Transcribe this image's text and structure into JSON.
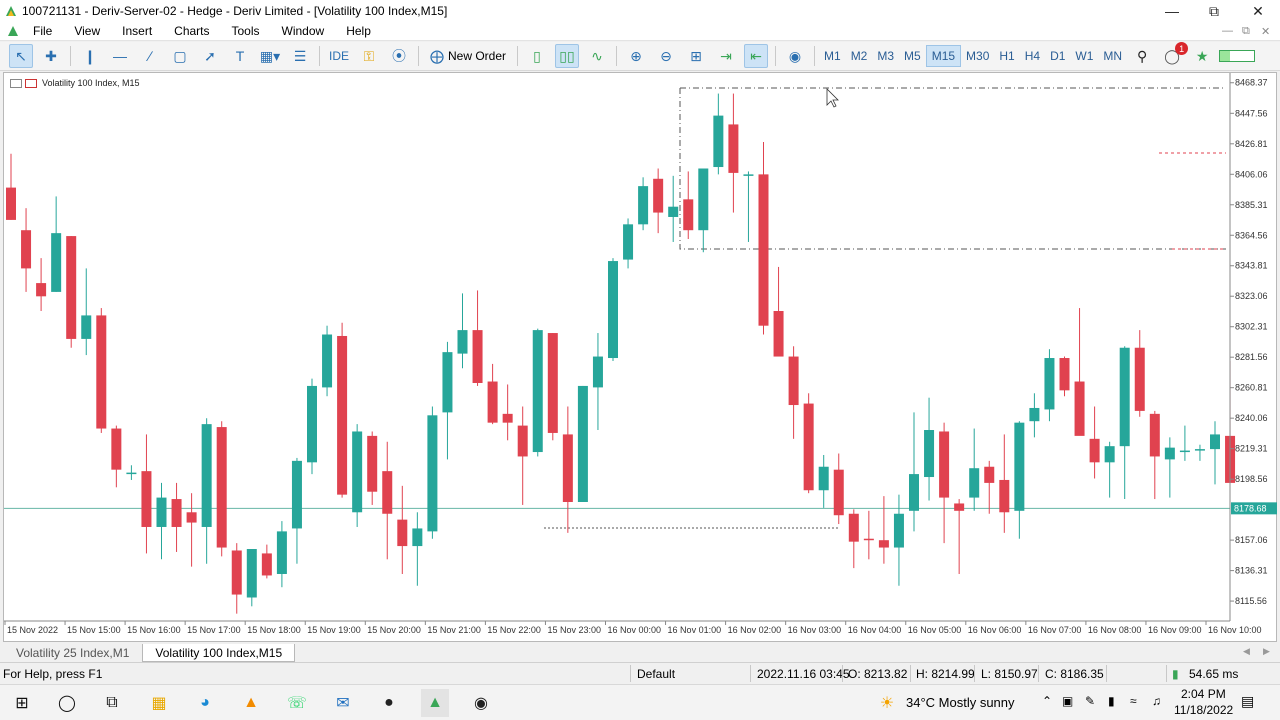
{
  "window": {
    "title": "100721131 - Deriv-Server-02 - Hedge - Deriv Limited - [Volatility 100 Index,M15]"
  },
  "menu": [
    "File",
    "View",
    "Insert",
    "Charts",
    "Tools",
    "Window",
    "Help"
  ],
  "toolbar": {
    "ide_label": "IDE",
    "new_order_label": "New Order",
    "timeframes": [
      "M1",
      "M2",
      "M3",
      "M5",
      "M15",
      "M30",
      "H1",
      "H4",
      "D1",
      "W1",
      "MN"
    ],
    "active_timeframe": "M15",
    "alerts_badge": "1"
  },
  "chart": {
    "caption": "Volatility 100 Index, M15",
    "bid_label": "8178.68",
    "colors": {
      "bull": "#26a69a",
      "bear": "#e0424f",
      "grid": "#e9e9e9"
    }
  },
  "chart_data": {
    "type": "candlestick",
    "symbol": "Volatility 100 Index",
    "timeframe": "M15",
    "ylim": [
      8102,
      8475
    ],
    "y_ticks": [
      8468.37,
      8447.56,
      8426.81,
      8406.06,
      8385.31,
      8364.56,
      8343.81,
      8323.06,
      8302.31,
      8281.56,
      8260.81,
      8240.06,
      8219.31,
      8198.56,
      8178.68,
      8157.06,
      8136.31,
      8115.56
    ],
    "x_labels": [
      "15 Nov 2022",
      "15 Nov 15:00",
      "15 Nov 16:00",
      "15 Nov 17:00",
      "15 Nov 18:00",
      "15 Nov 19:00",
      "15 Nov 20:00",
      "15 Nov 21:00",
      "15 Nov 22:00",
      "15 Nov 23:00",
      "16 Nov 00:00",
      "16 Nov 01:00",
      "16 Nov 02:00",
      "16 Nov 03:00",
      "16 Nov 04:00",
      "16 Nov 05:00",
      "16 Nov 06:00",
      "16 Nov 07:00",
      "16 Nov 08:00",
      "16 Nov 09:00",
      "16 Nov 10:00"
    ],
    "candles": [
      {
        "o": 8397,
        "h": 8420,
        "l": 8375,
        "c": 8375
      },
      {
        "o": 8368,
        "h": 8383,
        "l": 8326,
        "c": 8342
      },
      {
        "o": 8332,
        "h": 8349,
        "l": 8313,
        "c": 8323
      },
      {
        "o": 8326,
        "h": 8391,
        "l": 8326,
        "c": 8366
      },
      {
        "o": 8364,
        "h": 8364,
        "l": 8288,
        "c": 8294
      },
      {
        "o": 8294,
        "h": 8342,
        "l": 8283,
        "c": 8310
      },
      {
        "o": 8310,
        "h": 8315,
        "l": 8230,
        "c": 8233
      },
      {
        "o": 8233,
        "h": 8235,
        "l": 8193,
        "c": 8205
      },
      {
        "o": 8202,
        "h": 8208,
        "l": 8198,
        "c": 8203
      },
      {
        "o": 8204,
        "h": 8229,
        "l": 8148,
        "c": 8166
      },
      {
        "o": 8166,
        "h": 8196,
        "l": 8144,
        "c": 8186
      },
      {
        "o": 8185,
        "h": 8196,
        "l": 8149,
        "c": 8166
      },
      {
        "o": 8176,
        "h": 8189,
        "l": 8139,
        "c": 8169
      },
      {
        "o": 8166,
        "h": 8240,
        "l": 8141,
        "c": 8236
      },
      {
        "o": 8234,
        "h": 8238,
        "l": 8146,
        "c": 8152
      },
      {
        "o": 8150,
        "h": 8155,
        "l": 8107,
        "c": 8120
      },
      {
        "o": 8118,
        "h": 8150,
        "l": 8112,
        "c": 8151
      },
      {
        "o": 8148,
        "h": 8154,
        "l": 8131,
        "c": 8133
      },
      {
        "o": 8134,
        "h": 8170,
        "l": 8125,
        "c": 8163
      },
      {
        "o": 8165,
        "h": 8213,
        "l": 8141,
        "c": 8211
      },
      {
        "o": 8210,
        "h": 8267,
        "l": 8202,
        "c": 8262
      },
      {
        "o": 8261,
        "h": 8303,
        "l": 8255,
        "c": 8297
      },
      {
        "o": 8296,
        "h": 8305,
        "l": 8186,
        "c": 8188
      },
      {
        "o": 8176,
        "h": 8236,
        "l": 8166,
        "c": 8231
      },
      {
        "o": 8228,
        "h": 8231,
        "l": 8181,
        "c": 8190
      },
      {
        "o": 8204,
        "h": 8224,
        "l": 8144,
        "c": 8175
      },
      {
        "o": 8171,
        "h": 8194,
        "l": 8134,
        "c": 8153
      },
      {
        "o": 8153,
        "h": 8176,
        "l": 8126,
        "c": 8165
      },
      {
        "o": 8163,
        "h": 8248,
        "l": 8158,
        "c": 8242
      },
      {
        "o": 8244,
        "h": 8292,
        "l": 8212,
        "c": 8285
      },
      {
        "o": 8284,
        "h": 8325,
        "l": 8274,
        "c": 8300
      },
      {
        "o": 8300,
        "h": 8327,
        "l": 8262,
        "c": 8264
      },
      {
        "o": 8265,
        "h": 8277,
        "l": 8236,
        "c": 8237
      },
      {
        "o": 8243,
        "h": 8263,
        "l": 8225,
        "c": 8237
      },
      {
        "o": 8235,
        "h": 8248,
        "l": 8181,
        "c": 8214
      },
      {
        "o": 8217,
        "h": 8301,
        "l": 8214,
        "c": 8300
      },
      {
        "o": 8298,
        "h": 8298,
        "l": 8225,
        "c": 8230
      },
      {
        "o": 8229,
        "h": 8248,
        "l": 8162,
        "c": 8183
      },
      {
        "o": 8183,
        "h": 8262,
        "l": 8183,
        "c": 8262
      },
      {
        "o": 8261,
        "h": 8298,
        "l": 8232,
        "c": 8282
      },
      {
        "o": 8281,
        "h": 8349,
        "l": 8279,
        "c": 8347
      },
      {
        "o": 8348,
        "h": 8376,
        "l": 8342,
        "c": 8372
      },
      {
        "o": 8372,
        "h": 8404,
        "l": 8368,
        "c": 8398
      },
      {
        "o": 8403,
        "h": 8410,
        "l": 8366,
        "c": 8380
      },
      {
        "o": 8377,
        "h": 8405,
        "l": 8360,
        "c": 8384
      },
      {
        "o": 8389,
        "h": 8408,
        "l": 8362,
        "c": 8368
      },
      {
        "o": 8368,
        "h": 8410,
        "l": 8353,
        "c": 8410
      },
      {
        "o": 8411,
        "h": 8461,
        "l": 8406,
        "c": 8446
      },
      {
        "o": 8440,
        "h": 8461,
        "l": 8380,
        "c": 8407
      },
      {
        "o": 8406,
        "h": 8408,
        "l": 8360,
        "c": 8406
      },
      {
        "o": 8406,
        "h": 8428,
        "l": 8297,
        "c": 8303
      },
      {
        "o": 8313,
        "h": 8343,
        "l": 8283,
        "c": 8282
      },
      {
        "o": 8282,
        "h": 8289,
        "l": 8226,
        "c": 8249
      },
      {
        "o": 8250,
        "h": 8257,
        "l": 8189,
        "c": 8191
      },
      {
        "o": 8191,
        "h": 8215,
        "l": 8179,
        "c": 8207
      },
      {
        "o": 8205,
        "h": 8216,
        "l": 8168,
        "c": 8174
      },
      {
        "o": 8175,
        "h": 8178,
        "l": 8138,
        "c": 8156
      },
      {
        "o": 8158,
        "h": 8177,
        "l": 8144,
        "c": 8157
      },
      {
        "o": 8157,
        "h": 8187,
        "l": 8141,
        "c": 8152
      },
      {
        "o": 8152,
        "h": 8188,
        "l": 8126,
        "c": 8175
      },
      {
        "o": 8177,
        "h": 8244,
        "l": 8163,
        "c": 8202
      },
      {
        "o": 8200,
        "h": 8254,
        "l": 8184,
        "c": 8232
      },
      {
        "o": 8231,
        "h": 8237,
        "l": 8155,
        "c": 8186
      },
      {
        "o": 8182,
        "h": 8185,
        "l": 8134,
        "c": 8177
      },
      {
        "o": 8186,
        "h": 8233,
        "l": 8177,
        "c": 8206
      },
      {
        "o": 8207,
        "h": 8211,
        "l": 8175,
        "c": 8196
      },
      {
        "o": 8198,
        "h": 8229,
        "l": 8162,
        "c": 8176
      },
      {
        "o": 8177,
        "h": 8238,
        "l": 8158,
        "c": 8237
      },
      {
        "o": 8238,
        "h": 8257,
        "l": 8227,
        "c": 8247
      },
      {
        "o": 8246,
        "h": 8287,
        "l": 8238,
        "c": 8281
      },
      {
        "o": 8281,
        "h": 8282,
        "l": 8255,
        "c": 8259
      },
      {
        "o": 8265,
        "h": 8315,
        "l": 8252,
        "c": 8228
      },
      {
        "o": 8226,
        "h": 8248,
        "l": 8199,
        "c": 8210
      },
      {
        "o": 8210,
        "h": 8224,
        "l": 8186,
        "c": 8221
      },
      {
        "o": 8221,
        "h": 8289,
        "l": 8185,
        "c": 8288
      },
      {
        "o": 8288,
        "h": 8300,
        "l": 8241,
        "c": 8245
      },
      {
        "o": 8243,
        "h": 8245,
        "l": 8185,
        "c": 8214
      },
      {
        "o": 8212,
        "h": 8227,
        "l": 8186,
        "c": 8220
      },
      {
        "o": 8218,
        "h": 8235,
        "l": 8211,
        "c": 8218
      },
      {
        "o": 8218,
        "h": 8222,
        "l": 8211,
        "c": 8219
      },
      {
        "o": 8219,
        "h": 8238,
        "l": 8195,
        "c": 8229
      },
      {
        "o": 8228,
        "h": 8279,
        "l": 8197,
        "c": 8196
      }
    ],
    "bid": 8178.68,
    "ohlc_readout": {
      "time": "2022.11.16 03:45",
      "open": "O: 8213.82",
      "high": "H: 8214.99",
      "low": "L: 8150.97",
      "close": "C: 8186.35"
    }
  },
  "tabs": [
    "Volatility 25 Index,M1",
    "Volatility 100 Index,M15"
  ],
  "active_tab": "Volatility 100 Index,M15",
  "status": {
    "help": "For Help, press F1",
    "profile": "Default",
    "time": "2022.11.16 03:45",
    "open": "O: 8213.82",
    "high": "H: 8214.99",
    "low": "L: 8150.97",
    "close": "C: 8186.35",
    "ping": "54.65 ms"
  },
  "taskbar": {
    "weather": "34°C  Mostly sunny",
    "clock_time": "2:04 PM",
    "clock_date": "11/18/2022"
  }
}
